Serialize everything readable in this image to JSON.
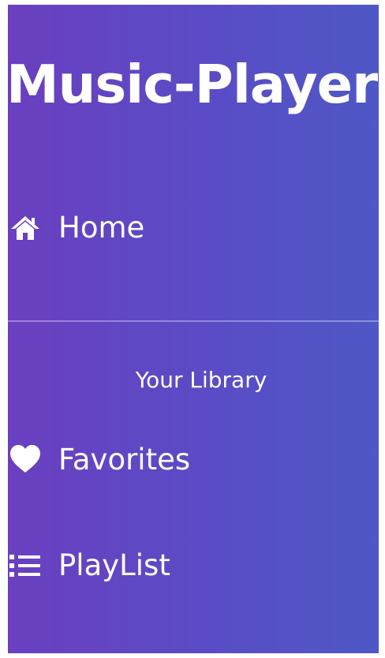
{
  "app": {
    "title": "Music-Player"
  },
  "nav": {
    "home": {
      "label": "Home",
      "icon": "home-icon"
    },
    "library_heading": "Your Library",
    "favorites": {
      "label": "Favorites",
      "icon": "heart-icon"
    },
    "playlist": {
      "label": "PlayList",
      "icon": "list-icon"
    }
  },
  "colors": {
    "gradient_start": "#6a3fc0",
    "gradient_end": "#4e58c6",
    "text": "#ffffff"
  }
}
